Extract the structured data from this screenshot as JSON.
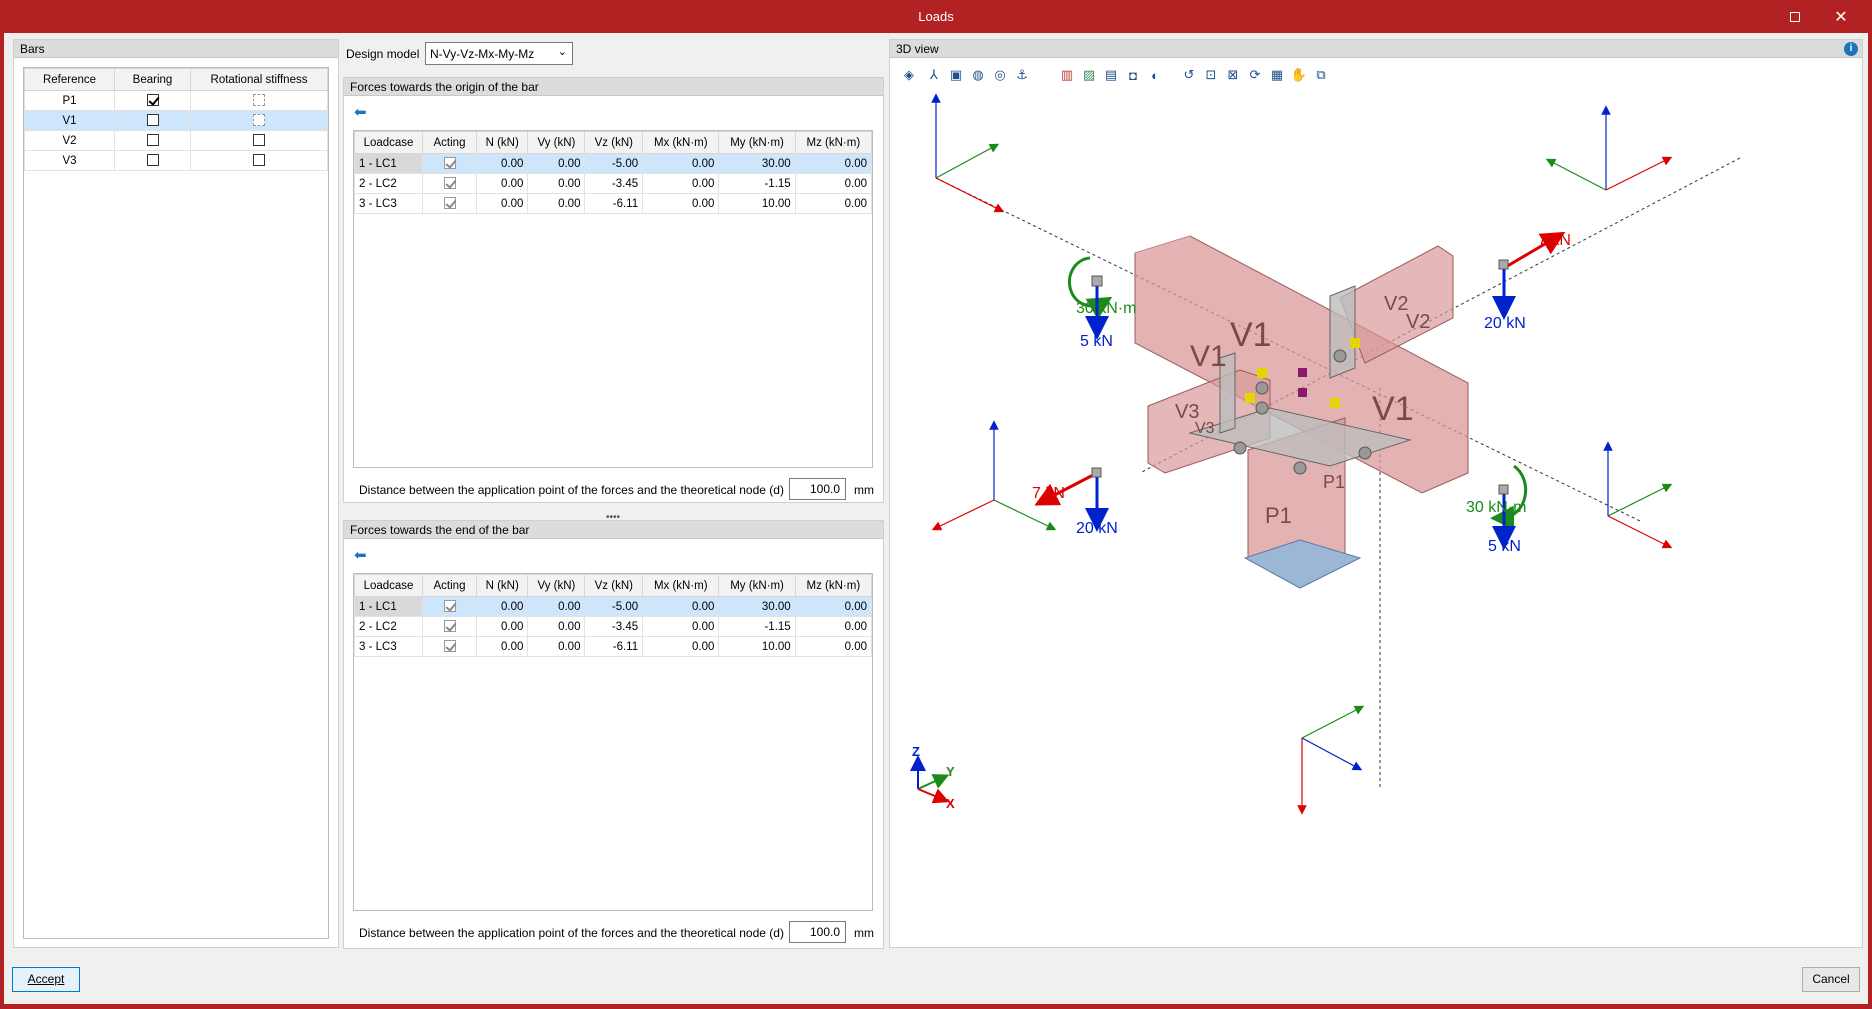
{
  "window": {
    "title": "Loads",
    "maximize_icon": "maximize-icon",
    "close_icon": "close-icon"
  },
  "bars": {
    "header": "Bars",
    "columns": [
      "Reference",
      "Bearing",
      "Rotational stiffness"
    ],
    "rows": [
      {
        "reference": "P1",
        "bearing": true,
        "rotational_stiffness": "disabled"
      },
      {
        "reference": "V1",
        "bearing": false,
        "rotational_stiffness": "disabled"
      },
      {
        "reference": "V2",
        "bearing": false,
        "rotational_stiffness": false
      },
      {
        "reference": "V3",
        "bearing": false,
        "rotational_stiffness": false
      }
    ]
  },
  "design_model": {
    "label": "Design model",
    "value": "N-Vy-Vz-Mx-My-Mz"
  },
  "origin": {
    "header": "Forces towards the origin of the bar",
    "distance_label": "Distance between the application point of the forces and the theoretical node (d)",
    "distance_value": "100.0",
    "distance_unit": "mm"
  },
  "end": {
    "header": "Forces towards the end of the bar",
    "distance_label": "Distance between the application point of the forces and the theoretical node (d)",
    "distance_value": "100.0",
    "distance_unit": "mm"
  },
  "forces_columns": [
    "Loadcase",
    "Acting",
    "N (kN)",
    "Vy (kN)",
    "Vz (kN)",
    "Mx (kN·m)",
    "My (kN·m)",
    "Mz (kN·m)"
  ],
  "forces_rows": [
    [
      "1 - LC1",
      "0.00",
      "0.00",
      "-5.00",
      "0.00",
      "30.00",
      "0.00"
    ],
    [
      "2 - LC2",
      "0.00",
      "0.00",
      "-3.45",
      "0.00",
      "-1.15",
      "0.00"
    ],
    [
      "3 - LC3",
      "0.00",
      "0.00",
      "-6.11",
      "0.00",
      "10.00",
      "0.00"
    ]
  ],
  "view3d": {
    "header": "3D view",
    "labels": {
      "v1_top": "V1",
      "v1_left": "V1",
      "v1_right": "V1",
      "v2": "V2",
      "v2b": "V2",
      "v3": "V3",
      "v3b": "V3",
      "p1": "P1",
      "p1b": "P1",
      "moment_left": "30 kN·m",
      "moment_right": "30 kN·m",
      "force_5_left": "5 kN",
      "force_5_right": "5 kN",
      "force_20_left": "20 kN",
      "force_20_right": "20 kN",
      "force_7_left": "7 kN",
      "force_7_right": "7 kN",
      "axis_x": "X",
      "axis_y": "Y",
      "axis_z": "Z",
      "ax_x": "x",
      "ax_y": "y",
      "ax_z": "z"
    }
  },
  "footer": {
    "accept": "Accept",
    "cancel": "Cancel"
  },
  "colors": {
    "title_bar": "#b22222",
    "selection": "#cde6fb",
    "beam": "#d99a9a",
    "force_arrow": "#0022cc",
    "moment": "#1b8a1b",
    "axial_force": "#dd0000"
  }
}
